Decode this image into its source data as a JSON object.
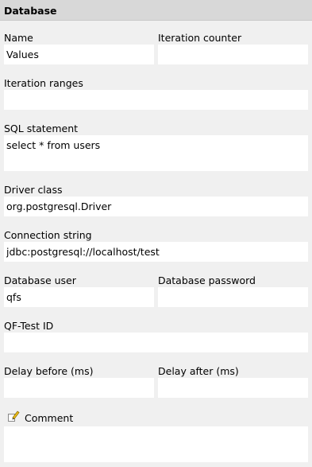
{
  "header": {
    "title": "Database"
  },
  "fields": {
    "name": {
      "label": "Name",
      "value": "Values"
    },
    "iteration_counter": {
      "label": "Iteration counter",
      "value": ""
    },
    "iteration_ranges": {
      "label": "Iteration ranges",
      "value": ""
    },
    "sql_statement": {
      "label": "SQL statement",
      "value": "select * from users"
    },
    "driver_class": {
      "label": "Driver class",
      "value": "org.postgresql.Driver"
    },
    "connection_string": {
      "label": "Connection string",
      "value": "jdbc:postgresql://localhost/test"
    },
    "database_user": {
      "label": "Database user",
      "value": "qfs"
    },
    "database_password": {
      "label": "Database password",
      "value": ""
    },
    "qftest_id": {
      "label": "QF-Test ID",
      "value": ""
    },
    "delay_before": {
      "label": "Delay before (ms)",
      "value": ""
    },
    "delay_after": {
      "label": "Delay after (ms)",
      "value": ""
    },
    "comment": {
      "label": "Comment",
      "value": ""
    }
  },
  "icons": {
    "comment": "pencil-icon"
  }
}
